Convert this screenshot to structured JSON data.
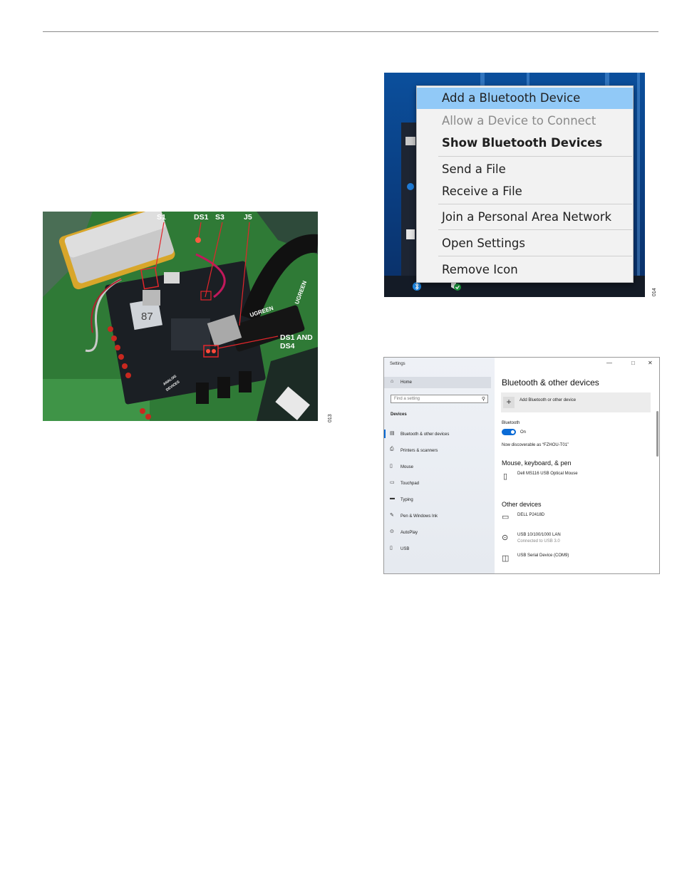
{
  "colors": {
    "menu_highlight": "#91c9f7",
    "desktop_blue": "#0b4f9c",
    "settings_accent": "#0a6bd6",
    "pcb_green": "#3a8a3f",
    "annotation_red": "#e3262b"
  },
  "figure_13": {
    "figure_number": "013",
    "labels": {
      "s1": "S1",
      "ds1": "DS1",
      "s3": "S3",
      "j5": "J5",
      "ds1_ds4_line1": "DS1 AND",
      "ds1_ds4_line2": "DS4"
    },
    "board_text": {
      "brand": "UGREEN",
      "brand2": "UGREEN",
      "chip_label": "87",
      "logo_line1": "ANALOG",
      "logo_line2": "DEVICES"
    }
  },
  "figure_14": {
    "figure_number": "014",
    "menu_items": [
      {
        "label": "Add a Bluetooth Device",
        "state": "highlighted"
      },
      {
        "label": "Allow a Device to Connect",
        "state": "disabled"
      },
      {
        "label": "Show Bluetooth Devices",
        "state": "bold"
      },
      {
        "label": "Send a File",
        "state": "normal"
      },
      {
        "label": "Receive a File",
        "state": "normal"
      },
      {
        "label": "Join a Personal Area Network",
        "state": "normal"
      },
      {
        "label": "Open Settings",
        "state": "normal"
      },
      {
        "label": "Remove Icon",
        "state": "normal"
      }
    ],
    "tray_icons": [
      "bluetooth-icon",
      "windows-security-icon"
    ]
  },
  "settings": {
    "window_title": "Settings",
    "window_controls": {
      "minimize": "—",
      "maximize": "□",
      "close": "✕"
    },
    "sidebar": {
      "home": "Home",
      "search_placeholder": "Find a setting",
      "section": "Devices",
      "items": [
        {
          "label": "Bluetooth & other devices",
          "icon": "bluetooth-devices-icon"
        },
        {
          "label": "Printers & scanners",
          "icon": "printer-icon"
        },
        {
          "label": "Mouse",
          "icon": "mouse-icon"
        },
        {
          "label": "Touchpad",
          "icon": "touchpad-icon"
        },
        {
          "label": "Typing",
          "icon": "keyboard-icon"
        },
        {
          "label": "Pen & Windows Ink",
          "icon": "pen-icon"
        },
        {
          "label": "AutoPlay",
          "icon": "autoplay-icon"
        },
        {
          "label": "USB",
          "icon": "usb-icon"
        }
      ]
    },
    "main": {
      "title": "Bluetooth & other devices",
      "add_device": "Add Bluetooth or other device",
      "bluetooth_label": "Bluetooth",
      "toggle_state": "On",
      "discoverable": "Now discoverable as “FZHOU-T01”",
      "mouse_section": "Mouse, keyboard, & pen",
      "mouse_device": "Dell MS116 USB Optical Mouse",
      "other_section": "Other devices",
      "other_devices": [
        {
          "name": "DELL P2418D",
          "status": ""
        },
        {
          "name": "USB 10/100/1000 LAN",
          "status": "Connected to USB 3.0"
        },
        {
          "name": "USB Serial Device (COM9)",
          "status": ""
        }
      ]
    }
  }
}
